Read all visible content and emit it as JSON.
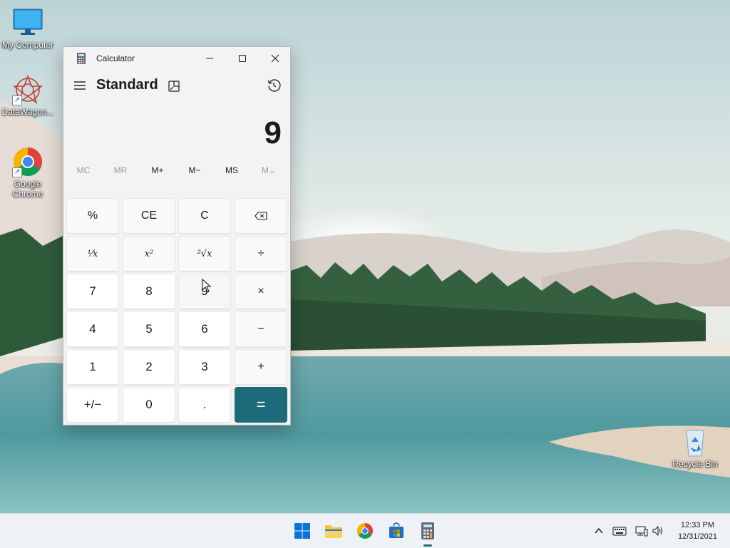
{
  "desktop": {
    "icons": [
      {
        "label": "My Computer",
        "icon": "monitor-icon"
      },
      {
        "label": "DataWagon...",
        "icon": "datawagon-icon"
      },
      {
        "label": "Google Chrome",
        "icon": "chrome-icon"
      },
      {
        "label": "Recycle Bin",
        "icon": "recycle-bin-icon"
      }
    ]
  },
  "calculator": {
    "window_title": "Calculator",
    "mode": "Standard",
    "display_value": "9",
    "memory": [
      "MC",
      "MR",
      "M+",
      "M−",
      "MS",
      "M⌄"
    ],
    "keys": [
      [
        "%",
        "CE",
        "C",
        "⌫"
      ],
      [
        "¹⁄x",
        "x²",
        "²√x",
        "÷"
      ],
      [
        "7",
        "8",
        "9",
        "×"
      ],
      [
        "4",
        "5",
        "6",
        "−"
      ],
      [
        "1",
        "2",
        "3",
        "+"
      ],
      [
        "+/−",
        "0",
        ".",
        "="
      ]
    ],
    "accent": "#1b6b7a"
  },
  "taskbar": {
    "apps": [
      "start-icon",
      "file-explorer-icon",
      "chrome-icon",
      "store-icon",
      "calculator-icon"
    ],
    "tray": [
      "chevron-up-icon",
      "keyboard-icon",
      "network-icon",
      "volume-icon"
    ],
    "time": "12:33 PM",
    "date": "12/31/2021"
  }
}
